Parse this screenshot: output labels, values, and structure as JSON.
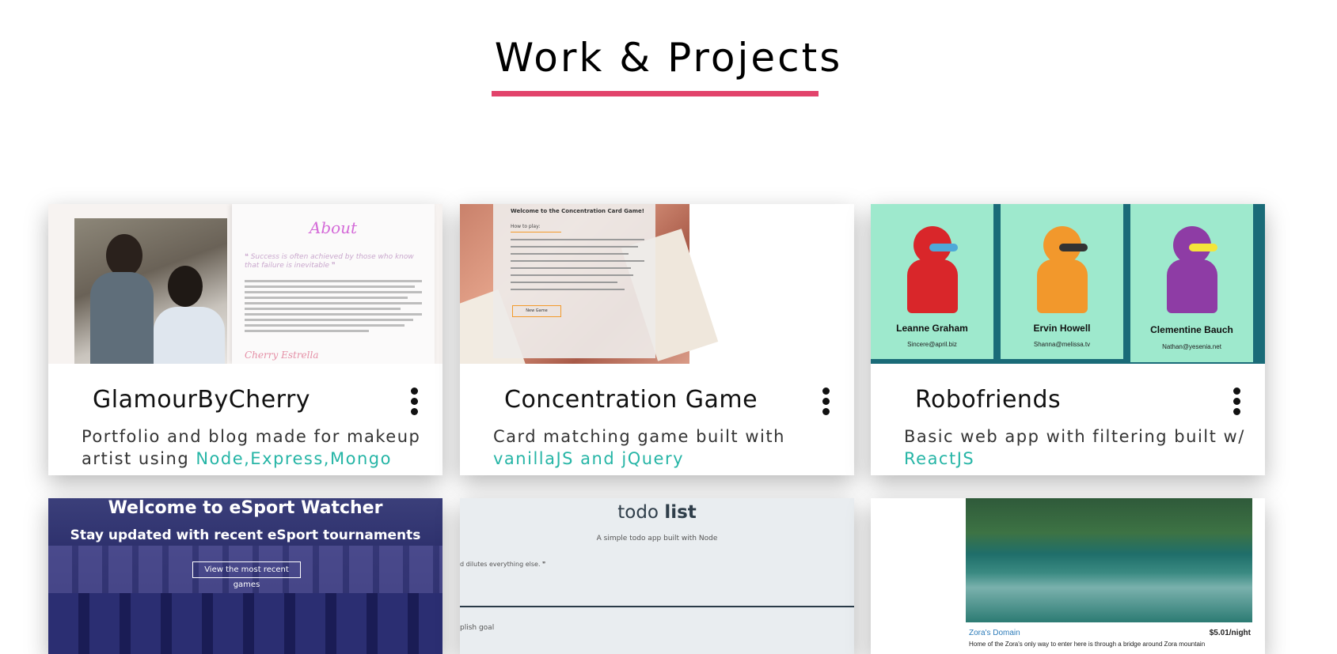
{
  "section": {
    "title": "Work & Projects",
    "accent_color": "#e2436b",
    "tech_color": "#26b5a6"
  },
  "projects": [
    {
      "title": "GlamourByCherry",
      "desc_prefix": "Portfolio and blog made for makeup artist using ",
      "tech": "Node,Express,Mongo",
      "menu_icon": "more-vert-icon",
      "image": {
        "heading": "About",
        "quote": "❝ Success is often achieved by those who know that failure is inevitable ❞",
        "signature": "Cherry Estrella"
      }
    },
    {
      "title": "Concentration Game",
      "desc_prefix": "Card matching game built with ",
      "tech": "vanillaJS and jQuery",
      "menu_icon": "more-vert-icon",
      "image": {
        "heading": "Welcome to the Concentration Card Game!",
        "subheading": "How to play:",
        "button": "New Game"
      }
    },
    {
      "title": "Robofriends",
      "desc_prefix": "Basic web app with filtering built w/ ",
      "tech": "ReactJS",
      "menu_icon": "more-vert-icon",
      "image": {
        "robots": [
          {
            "name": "Leanne Graham",
            "email": "Sincere@april.biz"
          },
          {
            "name": "Ervin Howell",
            "email": "Shanna@melissa.tv"
          },
          {
            "name": "Clementine Bauch",
            "email": "Nathan@yesenia.net"
          }
        ]
      }
    },
    {
      "image": {
        "title": "Welcome to eSport Watcher",
        "subtitle": "Stay updated with recent eSport tournaments",
        "button": "View the most recent games"
      }
    },
    {
      "image": {
        "title_light": "todo ",
        "title_bold": "list",
        "subtitle": "A simple todo app built with Node",
        "quote_fragment": "d dilutes everything else. ❞",
        "goal_fragment": "plish goal"
      }
    },
    {
      "image": {
        "place": "Zora's Domain",
        "price": "$5.01/night",
        "desc": "Home of the Zora's only way to enter here is through a bridge around Zora mountain"
      }
    }
  ]
}
